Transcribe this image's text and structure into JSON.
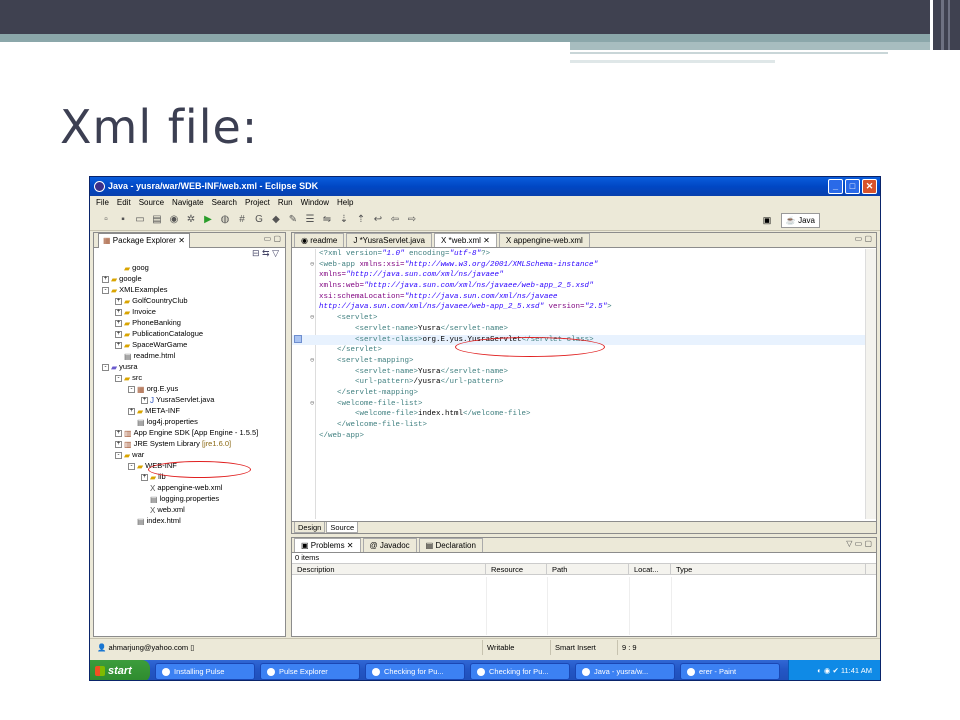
{
  "slide_title": "Xml file:",
  "window": {
    "title": "Java - yusra/war/WEB-INF/web.xml - Eclipse SDK",
    "controls": {
      "minimize": "_",
      "maximize": "□",
      "close": "✕"
    }
  },
  "menu": [
    "File",
    "Edit",
    "Source",
    "Navigate",
    "Search",
    "Project",
    "Run",
    "Window",
    "Help"
  ],
  "perspective": {
    "label": "Java"
  },
  "package_explorer": {
    "tab_label": "Package Explorer",
    "tree": [
      {
        "label": "goog",
        "kind": "folder",
        "depth": 1,
        "expander": ""
      },
      {
        "label": "google",
        "kind": "folder",
        "depth": 0,
        "expander": "+"
      },
      {
        "label": "XMLExamples",
        "kind": "folder",
        "depth": 0,
        "expander": "-"
      },
      {
        "label": "GolfCountryClub",
        "kind": "folder",
        "depth": 1,
        "expander": "+"
      },
      {
        "label": "Invoice",
        "kind": "folder",
        "depth": 1,
        "expander": "+"
      },
      {
        "label": "PhoneBanking",
        "kind": "folder",
        "depth": 1,
        "expander": "+"
      },
      {
        "label": "PublicationCatalogue",
        "kind": "folder",
        "depth": 1,
        "expander": "+"
      },
      {
        "label": "SpaceWarGame",
        "kind": "folder",
        "depth": 1,
        "expander": "+"
      },
      {
        "label": "readme.html",
        "kind": "file",
        "depth": 1,
        "expander": ""
      },
      {
        "label": "yusra",
        "kind": "project",
        "depth": 0,
        "expander": "-"
      },
      {
        "label": "src",
        "kind": "folder",
        "depth": 1,
        "expander": "-"
      },
      {
        "label": "org.E.yus",
        "kind": "package",
        "depth": 2,
        "expander": "-"
      },
      {
        "label": "YusraServlet.java",
        "kind": "java",
        "depth": 3,
        "expander": "+"
      },
      {
        "label": "META-INF",
        "kind": "folder",
        "depth": 2,
        "expander": "+"
      },
      {
        "label": "log4j.properties",
        "kind": "file",
        "depth": 2,
        "expander": ""
      },
      {
        "label": "App Engine SDK [App Engine - 1.5.5]",
        "kind": "library",
        "depth": 1,
        "expander": "+"
      },
      {
        "label": "JRE System Library",
        "suffix": "[jre1.6.0]",
        "kind": "library",
        "depth": 1,
        "expander": "+"
      },
      {
        "label": "war",
        "kind": "folder",
        "depth": 1,
        "expander": "-"
      },
      {
        "label": "WEB-INF",
        "kind": "folder",
        "depth": 2,
        "expander": "-"
      },
      {
        "label": "lib",
        "kind": "folder",
        "depth": 3,
        "expander": "+"
      },
      {
        "label": "appengine-web.xml",
        "kind": "xml",
        "depth": 3,
        "expander": ""
      },
      {
        "label": "logging.properties",
        "kind": "file",
        "depth": 3,
        "expander": ""
      },
      {
        "label": "web.xml",
        "kind": "xml",
        "depth": 3,
        "expander": ""
      },
      {
        "label": "index.html",
        "kind": "file",
        "depth": 2,
        "expander": ""
      }
    ]
  },
  "editor": {
    "tabs": [
      {
        "label": "readme",
        "active": false
      },
      {
        "label": "*YusraServlet.java",
        "active": false
      },
      {
        "label": "*web.xml",
        "active": true
      },
      {
        "label": "appengine-web.xml",
        "active": false
      }
    ],
    "lines": [
      [
        {
          "t": "<?xml version=",
          "c": "tg"
        },
        {
          "t": "\"1.0\"",
          "c": "av"
        },
        {
          "t": " encoding=",
          "c": "tg"
        },
        {
          "t": "\"utf-8\"",
          "c": "av"
        },
        {
          "t": "?>",
          "c": "tg"
        }
      ],
      [
        {
          "t": "<web-app ",
          "c": "tg"
        },
        {
          "t": "xmlns:xsi=",
          "c": "at"
        },
        {
          "t": "\"http://www.w3.org/2001/XMLSchema-instance\"",
          "c": "av"
        }
      ],
      [
        {
          "t": "xmlns=",
          "c": "at"
        },
        {
          "t": "\"http://java.sun.com/xml/ns/javaee\"",
          "c": "av"
        }
      ],
      [
        {
          "t": "xmlns:web=",
          "c": "at"
        },
        {
          "t": "\"http://java.sun.com/xml/ns/javaee/web-app_2_5.xsd\"",
          "c": "av"
        }
      ],
      [
        {
          "t": "xsi:schemaLocation=",
          "c": "at"
        },
        {
          "t": "\"http://java.sun.com/xml/ns/javaee",
          "c": "av"
        }
      ],
      [
        {
          "t": "http://java.sun.com/xml/ns/javaee/web-app_2_5.xsd\"",
          "c": "av"
        },
        {
          "t": " version=",
          "c": "at"
        },
        {
          "t": "\"2.5\"",
          "c": "av"
        },
        {
          "t": ">",
          "c": "tg"
        }
      ],
      [
        {
          "t": "    <servlet>",
          "c": "tg"
        }
      ],
      [
        {
          "t": "        <servlet-name>",
          "c": "tg"
        },
        {
          "t": "Yusra",
          "c": "tx"
        },
        {
          "t": "</servlet-name>",
          "c": "tg"
        }
      ],
      [
        {
          "t": "        <servlet-class>",
          "c": "tg"
        },
        {
          "t": "org.E.yus.YusraServlet",
          "c": "tx"
        },
        {
          "t": "</servlet-class>",
          "c": "tg"
        }
      ],
      [
        {
          "t": "    </servlet>",
          "c": "tg"
        }
      ],
      [
        {
          "t": "    <servlet-mapping>",
          "c": "tg"
        }
      ],
      [
        {
          "t": "        <servlet-name>",
          "c": "tg"
        },
        {
          "t": "Yusra",
          "c": "tx"
        },
        {
          "t": "</servlet-name>",
          "c": "tg"
        }
      ],
      [
        {
          "t": "        <url-pattern>",
          "c": "tg"
        },
        {
          "t": "/yusra",
          "c": "tx"
        },
        {
          "t": "</url-pattern>",
          "c": "tg"
        }
      ],
      [
        {
          "t": "    </servlet-mapping>",
          "c": "tg"
        }
      ],
      [
        {
          "t": "    <welcome-file-list>",
          "c": "tg"
        }
      ],
      [
        {
          "t": "        <welcome-file>",
          "c": "tg"
        },
        {
          "t": "index.html",
          "c": "tx"
        },
        {
          "t": "</welcome-file>",
          "c": "tg"
        }
      ],
      [
        {
          "t": "    </welcome-file-list>",
          "c": "tg"
        }
      ],
      [
        {
          "t": "</web-app>",
          "c": "tg"
        }
      ]
    ],
    "bottom_tabs": [
      {
        "label": "Design",
        "active": false
      },
      {
        "label": "Source",
        "active": true
      }
    ]
  },
  "problems": {
    "tabs": [
      {
        "label": "Problems",
        "active": true
      },
      {
        "label": "Javadoc",
        "active": false
      },
      {
        "label": "Declaration",
        "active": false
      }
    ],
    "count": "0 items",
    "columns": [
      "Description",
      "Resource",
      "Path",
      "Locat...",
      "Type"
    ]
  },
  "status": {
    "user": "ahmarjung@yahoo.com",
    "writable": "Writable",
    "insert_mode": "Smart Insert",
    "position": "9 : 9"
  },
  "taskbar": {
    "start": "start",
    "items": [
      "Installing Pulse",
      "Pulse Explorer",
      "Checking for Pu...",
      "Checking for Pu...",
      "Java - yusra/w...",
      "erer - Paint"
    ],
    "time": "11:41 AM"
  }
}
